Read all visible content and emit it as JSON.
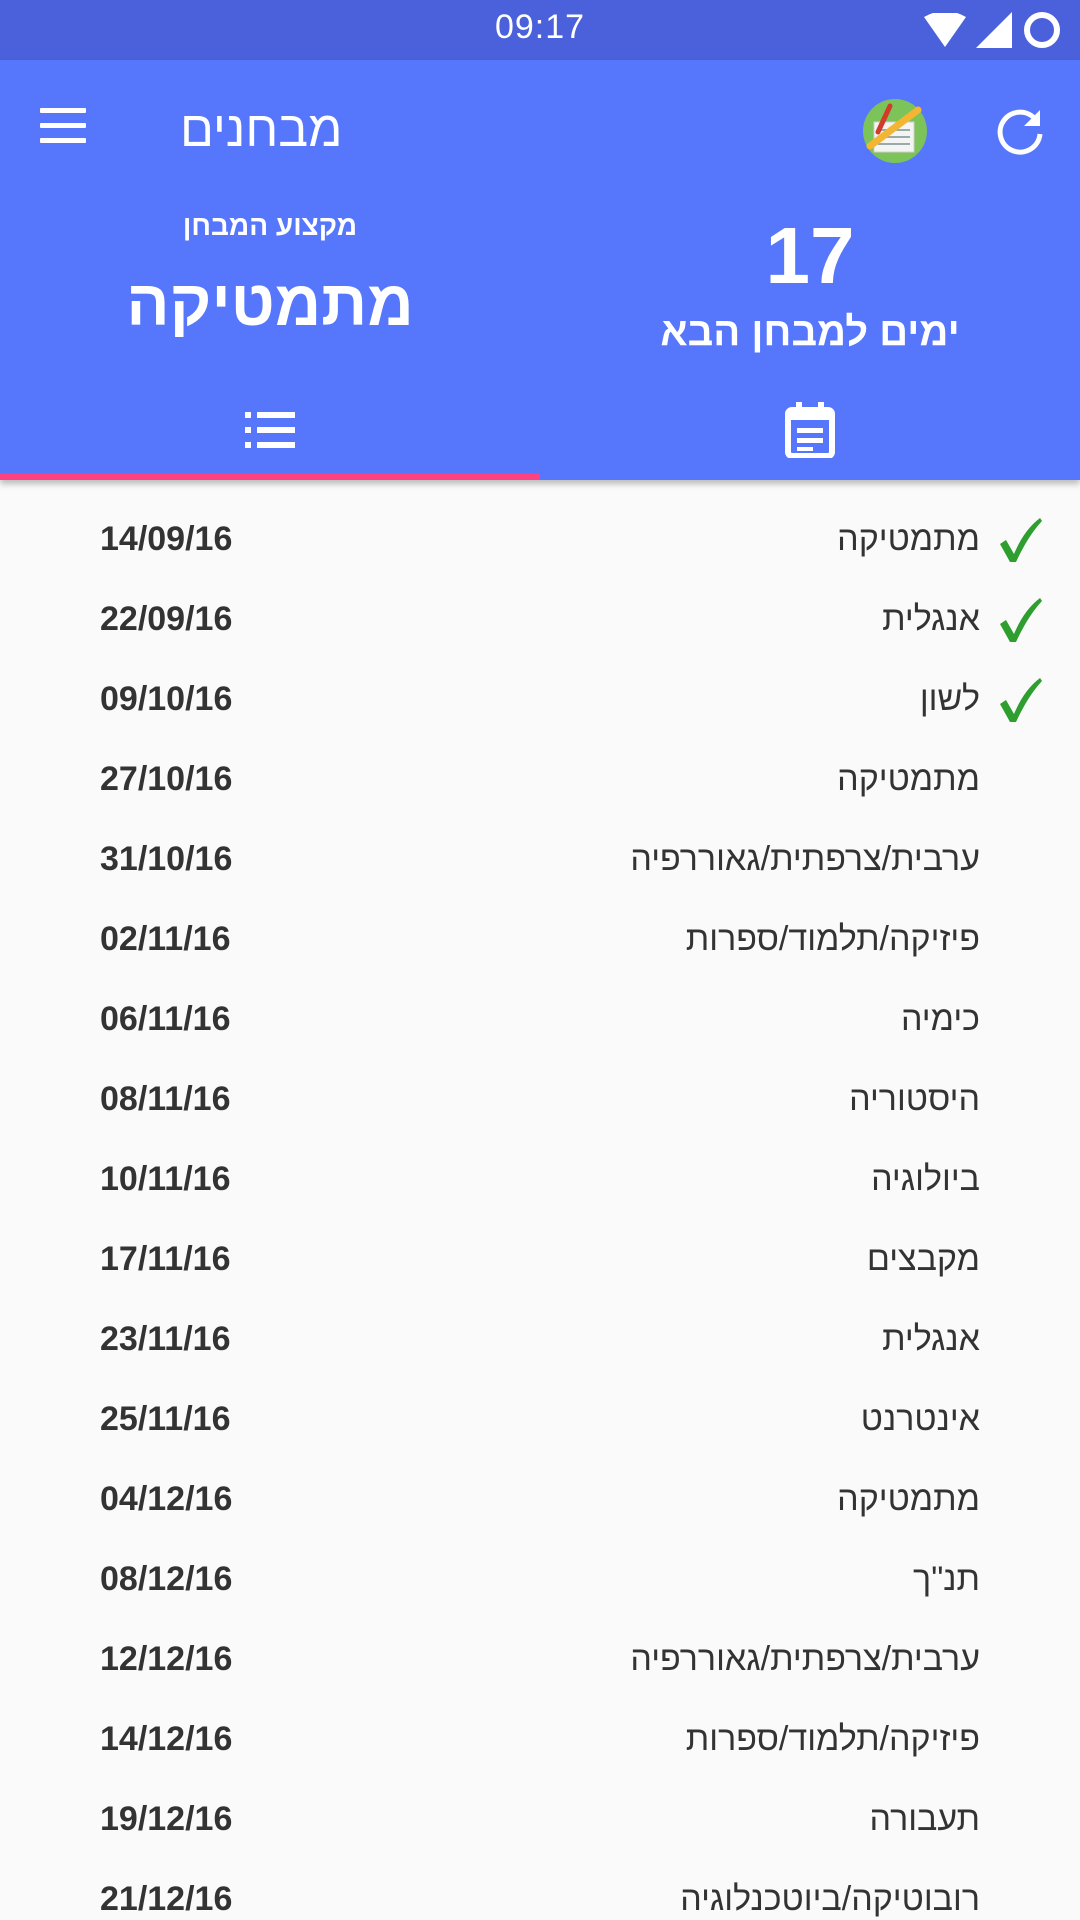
{
  "status_bar": {
    "time": "09:17"
  },
  "app": {
    "title": "מבחנים"
  },
  "summary": {
    "subject_caption": "מקצוע המבחן",
    "subject_value": "מתמטיקה",
    "days_count": "17",
    "days_caption": "ימים למבחן הבא"
  },
  "tabs": [
    {
      "icon": "list-icon",
      "selected": true
    },
    {
      "icon": "calendar-icon",
      "selected": false
    }
  ],
  "colors": {
    "status_bar": "#4a61db",
    "primary": "#5677fc",
    "accent": "#ff4081",
    "check": "#2e9e2e"
  },
  "exams": [
    {
      "subject": "מתמטיקה",
      "date": "14/09/16",
      "done": true
    },
    {
      "subject": "אנגלית",
      "date": "22/09/16",
      "done": true
    },
    {
      "subject": "לשון",
      "date": "09/10/16",
      "done": true
    },
    {
      "subject": "מתמטיקה",
      "date": "27/10/16",
      "done": false
    },
    {
      "subject": "ערבית/צרפתית/גאוררפיה",
      "date": "31/10/16",
      "done": false
    },
    {
      "subject": "פיזיקה/תלמוד/ספרות",
      "date": "02/11/16",
      "done": false
    },
    {
      "subject": "כימיה",
      "date": "06/11/16",
      "done": false
    },
    {
      "subject": "היסטוריה",
      "date": "08/11/16",
      "done": false
    },
    {
      "subject": "ביולוגיה",
      "date": "10/11/16",
      "done": false
    },
    {
      "subject": "מקבצים",
      "date": "17/11/16",
      "done": false
    },
    {
      "subject": "אנגלית",
      "date": "23/11/16",
      "done": false
    },
    {
      "subject": "אינטרנט",
      "date": "25/11/16",
      "done": false
    },
    {
      "subject": "מתמטיקה",
      "date": "04/12/16",
      "done": false
    },
    {
      "subject": "תנ\"ך",
      "date": "08/12/16",
      "done": false
    },
    {
      "subject": "ערבית/צרפתית/גאוררפיה",
      "date": "12/12/16",
      "done": false
    },
    {
      "subject": "פיזיקה/תלמוד/ספרות",
      "date": "14/12/16",
      "done": false
    },
    {
      "subject": "תעבורה",
      "date": "19/12/16",
      "done": false
    },
    {
      "subject": "רובוטיקה/ביוטכנלוגיה",
      "date": "21/12/16",
      "done": false
    }
  ]
}
